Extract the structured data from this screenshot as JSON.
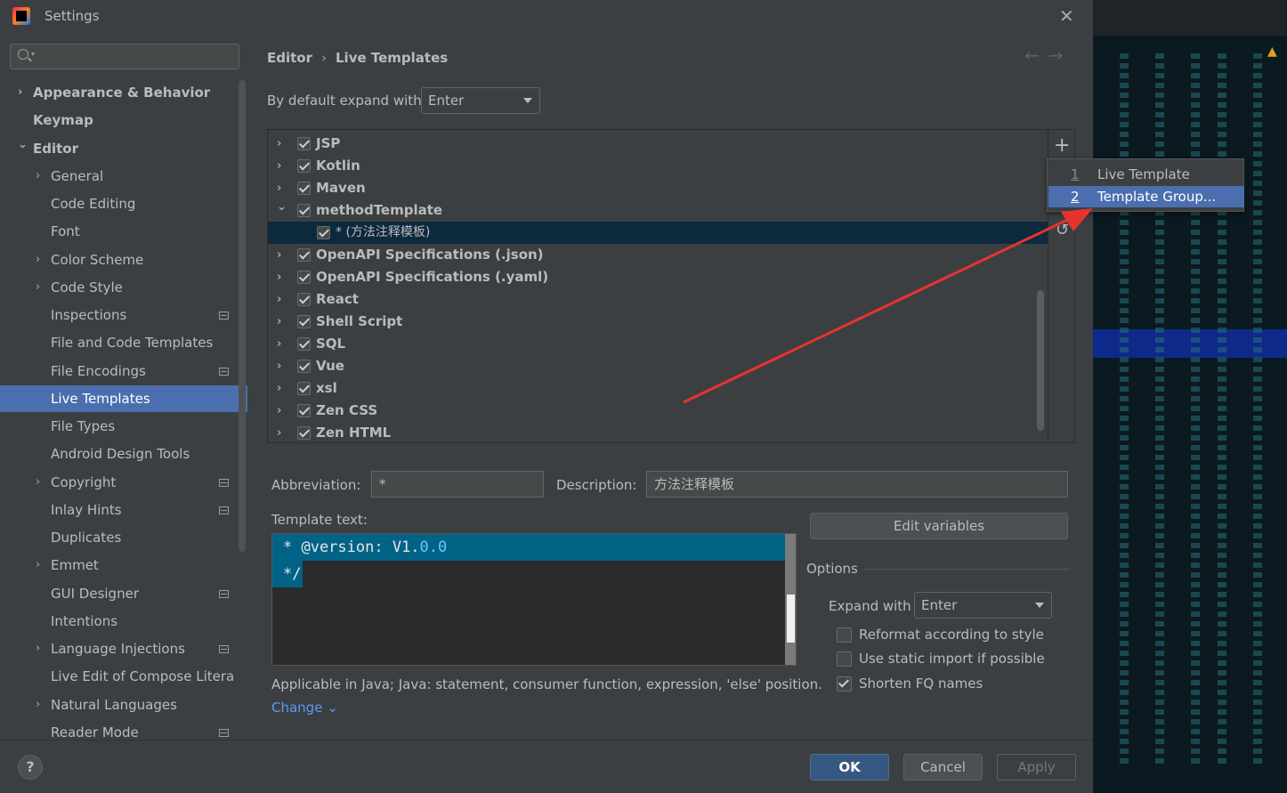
{
  "window": {
    "title": "Settings"
  },
  "sidebar": {
    "search_placeholder": "",
    "items": [
      {
        "label": "Appearance & Behavior",
        "bold": true,
        "chevron": "right",
        "indent": 0
      },
      {
        "label": "Keymap",
        "bold": true,
        "chevron": "none",
        "indent": 0
      },
      {
        "label": "Editor",
        "bold": true,
        "chevron": "down",
        "indent": 0
      },
      {
        "label": "General",
        "bold": false,
        "chevron": "right",
        "indent": 1
      },
      {
        "label": "Code Editing",
        "bold": false,
        "chevron": "none",
        "indent": 1
      },
      {
        "label": "Font",
        "bold": false,
        "chevron": "none",
        "indent": 1
      },
      {
        "label": "Color Scheme",
        "bold": false,
        "chevron": "right",
        "indent": 1
      },
      {
        "label": "Code Style",
        "bold": false,
        "chevron": "right",
        "indent": 1
      },
      {
        "label": "Inspections",
        "bold": false,
        "chevron": "none",
        "indent": 1,
        "badge": true
      },
      {
        "label": "File and Code Templates",
        "bold": false,
        "chevron": "none",
        "indent": 1
      },
      {
        "label": "File Encodings",
        "bold": false,
        "chevron": "none",
        "indent": 1,
        "badge": true
      },
      {
        "label": "Live Templates",
        "bold": false,
        "chevron": "none",
        "indent": 1,
        "selected": true
      },
      {
        "label": "File Types",
        "bold": false,
        "chevron": "none",
        "indent": 1
      },
      {
        "label": "Android Design Tools",
        "bold": false,
        "chevron": "none",
        "indent": 1
      },
      {
        "label": "Copyright",
        "bold": false,
        "chevron": "right",
        "indent": 1,
        "badge": true
      },
      {
        "label": "Inlay Hints",
        "bold": false,
        "chevron": "none",
        "indent": 1,
        "badge": true
      },
      {
        "label": "Duplicates",
        "bold": false,
        "chevron": "none",
        "indent": 1
      },
      {
        "label": "Emmet",
        "bold": false,
        "chevron": "right",
        "indent": 1
      },
      {
        "label": "GUI Designer",
        "bold": false,
        "chevron": "none",
        "indent": 1,
        "badge": true
      },
      {
        "label": "Intentions",
        "bold": false,
        "chevron": "none",
        "indent": 1
      },
      {
        "label": "Language Injections",
        "bold": false,
        "chevron": "right",
        "indent": 1,
        "badge": true
      },
      {
        "label": "Live Edit of Compose Litera",
        "bold": false,
        "chevron": "none",
        "indent": 1
      },
      {
        "label": "Natural Languages",
        "bold": false,
        "chevron": "right",
        "indent": 1
      },
      {
        "label": "Reader Mode",
        "bold": false,
        "chevron": "none",
        "indent": 1,
        "badge": true
      }
    ]
  },
  "breadcrumb": {
    "parent": "Editor",
    "separator": "›",
    "current": "Live Templates"
  },
  "nav_arrows": {
    "back": "←",
    "forward": "→"
  },
  "expand": {
    "label": "By default expand with",
    "value": "Enter"
  },
  "templates": [
    {
      "label": "JSP",
      "checked": true,
      "expanded": false,
      "child": false
    },
    {
      "label": "Kotlin",
      "checked": true,
      "expanded": false,
      "child": false
    },
    {
      "label": "Maven",
      "checked": true,
      "expanded": false,
      "child": false
    },
    {
      "label": "methodTemplate",
      "checked": true,
      "expanded": true,
      "child": false
    },
    {
      "label": "* (方法注释模板)",
      "checked": true,
      "expanded": false,
      "child": true,
      "selected": true
    },
    {
      "label": "OpenAPI Specifications (.json)",
      "checked": true,
      "expanded": false,
      "child": false
    },
    {
      "label": "OpenAPI Specifications (.yaml)",
      "checked": true,
      "expanded": false,
      "child": false
    },
    {
      "label": "React",
      "checked": true,
      "expanded": false,
      "child": false
    },
    {
      "label": "Shell Script",
      "checked": true,
      "expanded": false,
      "child": false
    },
    {
      "label": "SQL",
      "checked": true,
      "expanded": false,
      "child": false
    },
    {
      "label": "Vue",
      "checked": true,
      "expanded": false,
      "child": false
    },
    {
      "label": "xsl",
      "checked": true,
      "expanded": false,
      "child": false
    },
    {
      "label": "Zen CSS",
      "checked": true,
      "expanded": false,
      "child": false
    },
    {
      "label": "Zen HTML",
      "checked": true,
      "expanded": false,
      "child": false
    }
  ],
  "toolbar": {
    "add": "+",
    "restore": "↺"
  },
  "popup": {
    "items": [
      {
        "num": "1",
        "label": "Live Template"
      },
      {
        "num": "2",
        "label": "Template Group..."
      }
    ]
  },
  "form": {
    "abbreviation_label": "Abbreviation:",
    "abbreviation_value": "*",
    "description_label": "Description:",
    "description_value": "方法注释模板",
    "template_text_label": "Template text:",
    "edit_variables": "Edit variables"
  },
  "editor": {
    "line1_prefix": "* @version: V1.",
    "line1_num": "0.0",
    "line2": "*/"
  },
  "options": {
    "title": "Options",
    "expand_label": "Expand with",
    "expand_value": "Enter",
    "reformat": {
      "label": "Reformat according to style",
      "checked": false
    },
    "static_import": {
      "label": "Use static import if possible",
      "checked": false
    },
    "shorten_fq": {
      "label": "Shorten FQ names",
      "checked": true
    }
  },
  "applicable": {
    "text": "Applicable in Java; Java: statement, consumer function, expression, 'else' position.",
    "change_link": "Change"
  },
  "footer": {
    "help": "?",
    "ok": "OK",
    "cancel": "Cancel",
    "apply": "Apply"
  },
  "colors": {
    "accent": "#4b6eaf",
    "selection": "#0d293e",
    "arrow": "#e8322f"
  }
}
